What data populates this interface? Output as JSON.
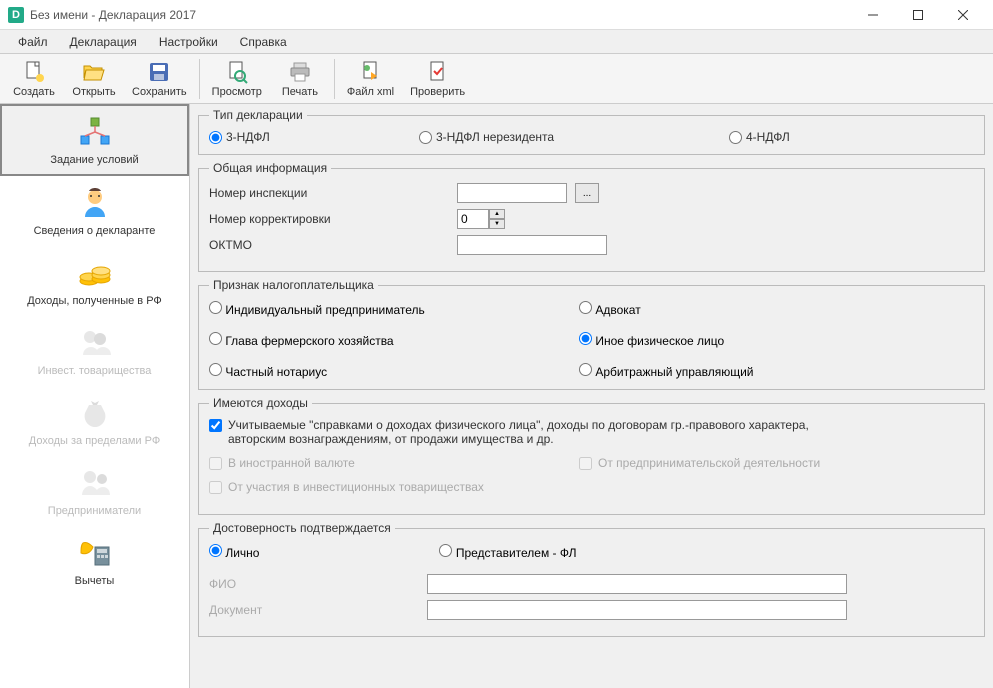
{
  "window": {
    "title": "Без имени - Декларация 2017"
  },
  "menu": {
    "file": "Файл",
    "declaration": "Декларация",
    "settings": "Настройки",
    "help": "Справка"
  },
  "toolbar": {
    "create": "Создать",
    "open": "Открыть",
    "save": "Сохранить",
    "preview": "Просмотр",
    "print": "Печать",
    "xml": "Файл xml",
    "check": "Проверить"
  },
  "sidebar": {
    "items": [
      {
        "label": "Задание условий"
      },
      {
        "label": "Сведения о декларанте"
      },
      {
        "label": "Доходы, полученные в РФ"
      },
      {
        "label": "Инвест. товарищества"
      },
      {
        "label": "Доходы за пределами РФ"
      },
      {
        "label": "Предприниматели"
      },
      {
        "label": "Вычеты"
      }
    ]
  },
  "groups": {
    "decl_type": {
      "legend": "Тип декларации",
      "ndfl3": "3-НДФЛ",
      "ndfl3nr": "3-НДФЛ нерезидента",
      "ndfl4": "4-НДФЛ"
    },
    "general": {
      "legend": "Общая информация",
      "inspection": "Номер инспекции",
      "inspection_val": "",
      "correction": "Номер корректировки",
      "correction_val": "0",
      "oktmo": "ОКТМО",
      "oktmo_val": "",
      "browse": "..."
    },
    "taxpayer": {
      "legend": "Признак налогоплательщика",
      "ip": "Индивидуальный предприниматель",
      "lawyer": "Адвокат",
      "farm": "Глава фермерского хозяйства",
      "other": "Иное физическое лицо",
      "notary": "Частный нотариус",
      "arb": "Арбитражный управляющий"
    },
    "income": {
      "legend": "Имеются доходы",
      "cert": "Учитываемые \"справками о доходах физического лица\", доходы по договорам гр.-правового характера, авторским вознаграждениям, от продажи имущества и др.",
      "foreign": "В иностранной валюте",
      "business": "От предпринимательской деятельности",
      "invest": "От участия в инвестиционных товариществах"
    },
    "confirm": {
      "legend": "Достоверность подтверждается",
      "personal": "Лично",
      "rep": "Представителем - ФЛ",
      "fio": "ФИО",
      "fio_val": "",
      "doc": "Документ",
      "doc_val": ""
    }
  }
}
